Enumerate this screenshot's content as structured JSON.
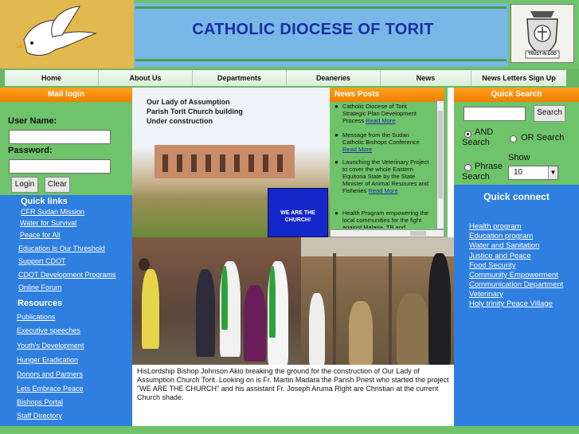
{
  "header": {
    "title": "CATHOLIC DIOCESE OF TORIT",
    "crest_motto": "TRUST IN GOD"
  },
  "nav": {
    "items": [
      "Home",
      "About Us",
      "Departments",
      "Deaneries",
      "News",
      "News Letters Sign Up"
    ]
  },
  "mail_login": {
    "heading": "Mail login",
    "username_label": "User Name:",
    "password_label": "Password:",
    "login_button": "Login",
    "clear_button": "Clear"
  },
  "quick_links": {
    "heading": "Quick links",
    "items": [
      "CFR Sudan Mission",
      "Water for Survival",
      "Peace for All",
      "Education is Our Threshold",
      "Support CDOT",
      "CDOT Development Programs",
      "Online Forum"
    ]
  },
  "resources": {
    "heading": "Resources",
    "items": [
      "Publications",
      "Executive speeches",
      "Youth's Development",
      "Hunger Eradication",
      "Donors and Partners",
      "Lets Embrace Peace",
      "Bishops Portal",
      "Staff Directory"
    ]
  },
  "feature": {
    "caption_lines": [
      "Our Lady of Assumption",
      "Parish Torit Church building",
      "Under construction"
    ],
    "banner_lines": [
      "WE ARE THE",
      "CHURCH!"
    ]
  },
  "news_posts": {
    "heading": "News Posts",
    "items": [
      {
        "text": "Catholic Diocese of Torit Strategic Plan Development Process",
        "link": "Read More"
      },
      {
        "text": "Message from the Sudan Catholic Bishops Conference",
        "link": "Read More"
      },
      {
        "text": "Launching the Veterinary Project to cover the whole Eastern Equitoria State by the State Minister of Animal Resoures and Fisheries",
        "link": "Read More"
      },
      {
        "text": "Health Program empowering the local communities for the fight against Malaria, TB and",
        "link": ""
      }
    ]
  },
  "photo_caption": "HisLordship Bishop Johnson Akio breaking the ground for the construction of Our Lady of Assumption Church Torit. Looking on is Fr. Martin Madara the Parish Priest who started the project \"WE ARE THE CHURCH\" and his assistant Fr. Joseph Aruma Right are Christian at the current Church shade.",
  "quick_search": {
    "heading": "Quick Search",
    "search_button": "Search",
    "and_search": "AND Search",
    "or_search": "OR Search",
    "phrase_search": "Phrase Search",
    "show_label": "Show",
    "show_value": "10"
  },
  "quick_connect": {
    "heading": "Quick connect",
    "items": [
      "Health program",
      "Education program",
      "Water and Sanitation",
      "Justice and Peace",
      "Food Security",
      "Community Empowerment",
      "Communication Department",
      "Veterinary",
      "Holy trinity Peace Village"
    ]
  },
  "colors": {
    "green": "#6fc36a",
    "blue": "#2f7fe0",
    "orange": "#f08a00",
    "title_blue": "#1b2fa3"
  }
}
